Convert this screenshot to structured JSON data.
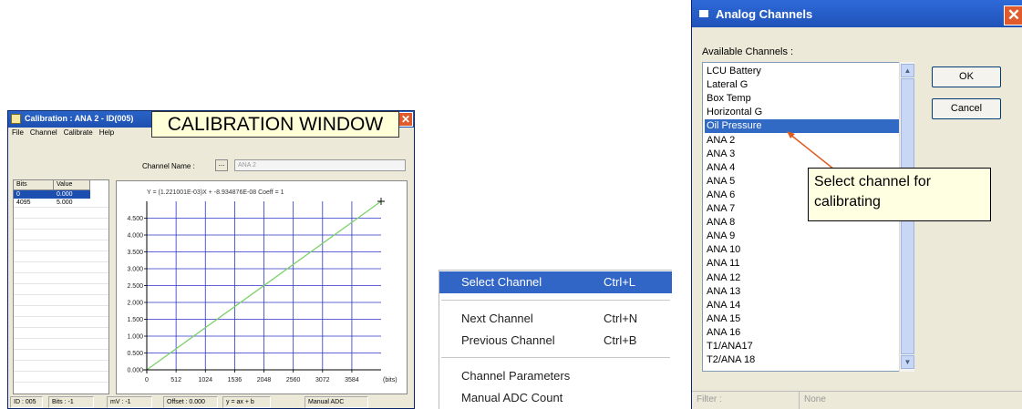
{
  "calibration": {
    "title": "Calibration : ANA 2 - ID(005)",
    "callout": "CALIBRATION WINDOW",
    "close_glyph": "✕",
    "menu": [
      "File",
      "Channel",
      "Calibrate",
      "Help"
    ],
    "channel_name_label": "Channel Name :",
    "browse_label": "...",
    "channel_name_value": "ANA 2",
    "table": {
      "headers": [
        "Bits",
        "Value"
      ],
      "rows": [
        [
          "0",
          "0.000"
        ],
        [
          "4095",
          "5.000"
        ]
      ]
    },
    "equation": "Y = (1.221001E-03)X + -8.934876E-08    Coeff = 1",
    "status": [
      "ID : 005",
      "Bits : -1",
      "mV : -1",
      "Offset : 0.000",
      "y = ax + b",
      "Manual ADC"
    ]
  },
  "chart_data": {
    "type": "line",
    "x": [
      0,
      4095
    ],
    "series": [
      {
        "values": [
          0.0,
          5.0
        ]
      }
    ],
    "x_ticks": [
      "0",
      "512",
      "1024",
      "1536",
      "2048",
      "2560",
      "3072",
      "3584"
    ],
    "y_ticks": [
      "0.000",
      "0.500",
      "1.000",
      "1.500",
      "2.000",
      "2.500",
      "3.000",
      "3.500",
      "4.000",
      "4.500"
    ],
    "xlabel": "(bits)",
    "ylabel": "",
    "xlim": [
      0,
      4095
    ],
    "ylim": [
      0,
      5
    ],
    "grid": true,
    "colors": {
      "line": "#7cd06a",
      "grid": "#2a35c8"
    }
  },
  "context_menu": {
    "items": [
      {
        "label": "Select Channel",
        "shortcut": "Ctrl+L"
      },
      {
        "label": "Next Channel",
        "shortcut": "Ctrl+N"
      },
      {
        "label": "Previous Channel",
        "shortcut": "Ctrl+B"
      },
      {
        "label": "Channel Parameters",
        "shortcut": ""
      },
      {
        "label": "Manual ADC Count",
        "shortcut": ""
      }
    ]
  },
  "analog": {
    "title": "Analog Channels",
    "close_glyph": "✕",
    "available_label": "Available Channels :",
    "channels": [
      "LCU Battery",
      "Lateral G",
      "Box Temp",
      "Horizontal G",
      "Oil Pressure",
      "ANA 2",
      "ANA 3",
      "ANA 4",
      "ANA 5",
      "ANA 6",
      "ANA 7",
      "ANA 8",
      "ANA 9",
      "ANA 10",
      "ANA 11",
      "ANA 12",
      "ANA 13",
      "ANA 14",
      "ANA 15",
      "ANA 16",
      "T1/ANA17",
      "T2/ANA 18"
    ],
    "selected": "Oil Pressure",
    "ok_label": "OK",
    "cancel_label": "Cancel",
    "callout": "Select channel for calibrating",
    "filter_label": "Filter :",
    "filter_value": "None",
    "accent": "#316ac5"
  }
}
